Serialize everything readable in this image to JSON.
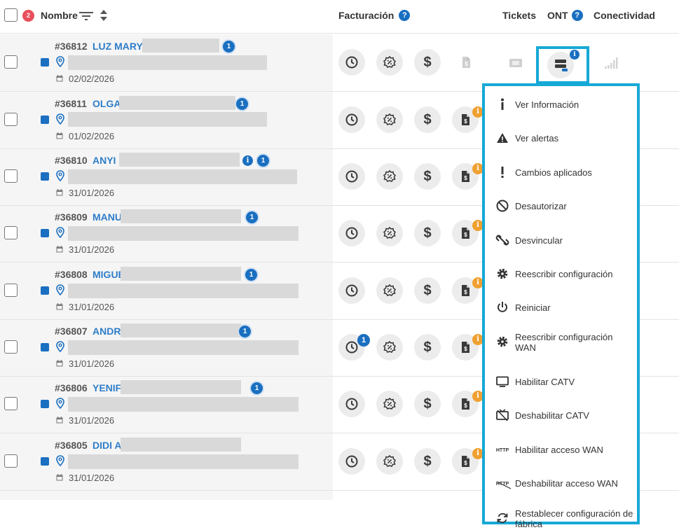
{
  "header": {
    "selected_count": "2",
    "nombre": "Nombre",
    "facturacion": "Facturación",
    "tickets": "Tickets",
    "ont": "ONT",
    "conectividad": "Conectividad",
    "help_glyph": "?"
  },
  "rows": [
    {
      "id": "#36812",
      "name": "LUZ MARY",
      "date": "02/02/2026"
    },
    {
      "id": "#36811",
      "name": "OLGA",
      "date": "01/02/2026"
    },
    {
      "id": "#36810",
      "name": "ANYI I",
      "date": "31/01/2026"
    },
    {
      "id": "#36809",
      "name": "MANU",
      "date": "31/01/2026"
    },
    {
      "id": "#36808",
      "name": "MIGUE",
      "date": "31/01/2026"
    },
    {
      "id": "#36807",
      "name": "ANDRI",
      "date": "31/01/2026"
    },
    {
      "id": "#36806",
      "name": "YENIF",
      "date": "31/01/2026"
    },
    {
      "id": "#36805",
      "name": "DIDI A",
      "date": "31/01/2026"
    }
  ],
  "badges": {
    "star": "1",
    "info": "i",
    "history_count": "1",
    "invoice_alert": "i",
    "ont_info": "i"
  },
  "billing": {
    "dollar": "$"
  },
  "ont_menu": [
    {
      "label": "Ver Información",
      "icon": "info-icon"
    },
    {
      "label": "Ver alertas",
      "icon": "warning-icon"
    },
    {
      "label": "Cambios aplicados",
      "icon": "exclamation-icon"
    },
    {
      "label": "Desautorizar",
      "icon": "block-icon"
    },
    {
      "label": "Desvincular",
      "icon": "unlink-icon"
    },
    {
      "label": "Reescribir configuración",
      "icon": "gear-icon"
    },
    {
      "label": "Reiniciar",
      "icon": "power-icon"
    },
    {
      "label": "Reescribir configuración WAN",
      "icon": "gear-icon"
    },
    {
      "label": "Habilitar CATV",
      "icon": "tv-icon"
    },
    {
      "label": "Deshabilitar CATV",
      "icon": "tv-off-icon"
    },
    {
      "label": "Habilitar acceso WAN",
      "icon": "http-icon"
    },
    {
      "label": "Deshabilitar acceso WAN",
      "icon": "http-off-icon"
    },
    {
      "label": "Restablecer configuración de fábrica",
      "icon": "reset-icon"
    }
  ],
  "menu_icon_text": {
    "http": "HTTP"
  },
  "colors": {
    "accent": "#1a6fc0",
    "highlight": "#17a9d6",
    "alert": "#e8505b",
    "warning": "#f0a030"
  }
}
